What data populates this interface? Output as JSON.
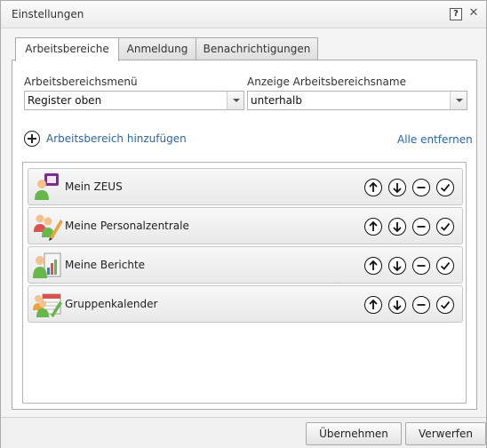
{
  "dialog": {
    "title": "Einstellungen",
    "help_label": "?",
    "close_label": "✕"
  },
  "tabs": [
    {
      "label": "Arbeitsbereiche",
      "active": true
    },
    {
      "label": "Anmeldung",
      "active": false
    },
    {
      "label": "Benachrichtigungen",
      "active": false
    }
  ],
  "fields": {
    "menu": {
      "label": "Arbeitsbereichsmenü",
      "value": "Register oben"
    },
    "display": {
      "label": "Anzeige Arbeitsbereichsname",
      "value": "unterhalb"
    }
  },
  "actions": {
    "add_label": "Arbeitsbereich hinzufügen",
    "remove_all_label": "Alle entfernen"
  },
  "workspaces": [
    {
      "label": "Mein ZEUS",
      "icon": "person-badge-icon"
    },
    {
      "label": "Meine Personalzentrale",
      "icon": "people-pencil-icon"
    },
    {
      "label": "Meine Berichte",
      "icon": "report-chart-icon"
    },
    {
      "label": "Gruppenkalender",
      "icon": "calendar-people-icon"
    }
  ],
  "row_actions": [
    "move-up",
    "move-down",
    "remove",
    "confirm"
  ],
  "footer": {
    "apply_label": "Übernehmen",
    "discard_label": "Verwerfen"
  },
  "colors": {
    "link": "#2a64a8",
    "border": "#a9a9a9"
  }
}
